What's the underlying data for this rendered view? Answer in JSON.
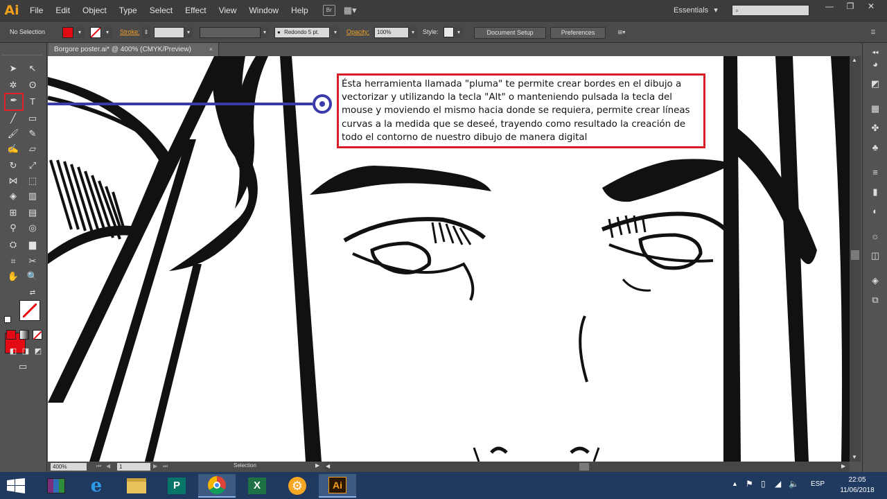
{
  "app": {
    "logo": "Ai",
    "menus": [
      "File",
      "Edit",
      "Object",
      "Type",
      "Select",
      "Effect",
      "View",
      "Window",
      "Help"
    ],
    "menu_bar_icon_label": "Br",
    "workspace": "Essentials",
    "workspace_arrow": "▾",
    "window_controls": [
      "—",
      "❐",
      "✕"
    ]
  },
  "control": {
    "selection_state": "No Selection",
    "stroke_label": "Stroke:",
    "brush_label": "Redondo 5 pt.",
    "opacity_label": "Opacity:",
    "opacity_value": "100%",
    "style_label": "Style:",
    "document_setup": "Document Setup",
    "preferences": "Preferences",
    "fill_color": "#e30b13"
  },
  "document": {
    "tab_title": "Borgore poster.ai* @ 400% (CMYK/Preview)",
    "tab_close": "×",
    "zoom": "400%",
    "artboard": "1",
    "status": "Selection"
  },
  "annotation": {
    "text": "Ésta herramienta llamada \"pluma\" te permite crear bordes en el dibujo a vectorizar y utilizando la tecla \"Alt\" o manteniendo pulsada la tecla del mouse y moviendo el mismo hacia donde se requiera, permite crear líneas curvas a la medida que se deseé, trayendo como resultado la creación de todo el contorno de nuestro dibujo de manera digital",
    "border_color": "#d91c2a",
    "pointer_color": "#3a3aa8"
  },
  "taskbar": {
    "language": "ESP",
    "time": "22:05",
    "date": "11/06/2018",
    "apps": [
      "winrar-icon",
      "internet-explorer-icon",
      "file-explorer-icon",
      "publisher-icon",
      "chrome-icon",
      "excel-icon",
      "settings-app-icon",
      "illustrator-icon"
    ],
    "publisher_label": "P",
    "excel_label": "X",
    "illustrator_label": "Ai"
  }
}
